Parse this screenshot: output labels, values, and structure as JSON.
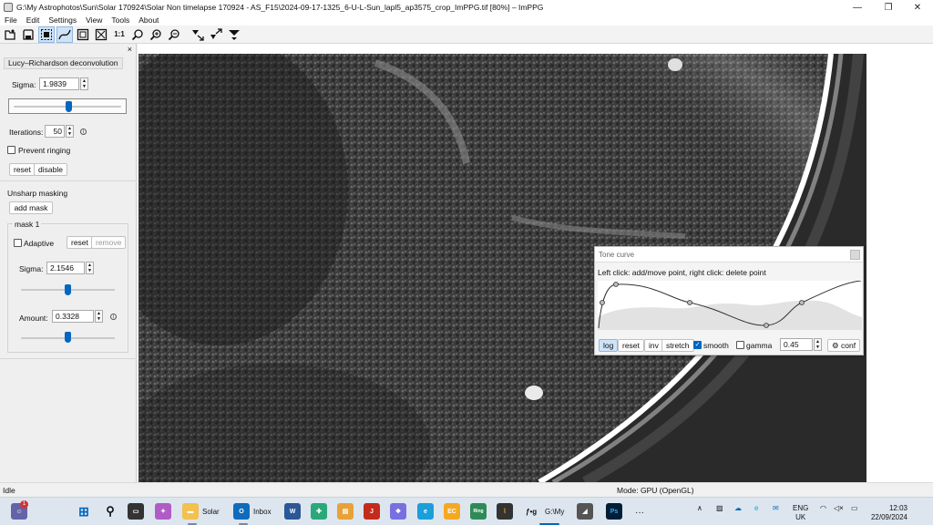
{
  "window": {
    "title": "G:\\My Astrophotos\\Sun\\Solar 170924\\Solar Non timelapse 170924 - AS_F15\\2024-09-17-1325_6-U-L-Sun_lapl5_ap3575_crop_ImPPG.tif [80%] – ImPPG",
    "minimize": "—",
    "maximize": "❐",
    "close": "✕"
  },
  "menu": [
    "File",
    "Edit",
    "Settings",
    "View",
    "Tools",
    "About"
  ],
  "toolbar": {
    "actual_size": "1:1"
  },
  "panel": {
    "close": "×",
    "lucy": {
      "title": "Lucy–Richardson deconvolution",
      "sigma_label": "Sigma:",
      "sigma_value": "1.9839",
      "iterations_label": "Iterations:",
      "iterations_value": "50",
      "prevent_ringing": "Prevent ringing",
      "reset": "reset",
      "disable": "disable"
    },
    "unsharp": {
      "title": "Unsharp masking",
      "add_mask": "add mask",
      "mask_title": "mask 1",
      "adaptive": "Adaptive",
      "reset": "reset",
      "remove": "remove",
      "sigma_label": "Sigma:",
      "sigma_value": "2.1546",
      "amount_label": "Amount:",
      "amount_value": "0.3328"
    }
  },
  "tone_curve": {
    "title": "Tone curve",
    "hint": "Left click: add/move point, right click: delete point",
    "log": "log",
    "reset": "reset",
    "inv": "inv",
    "stretch": "stretch",
    "smooth": "smooth",
    "smooth_checked": true,
    "gamma": "gamma",
    "gamma_checked": false,
    "gamma_value": "0.45",
    "conf": "conf"
  },
  "status": {
    "left": "Idle",
    "mode": "Mode: GPU (OpenGL)"
  },
  "taskbar": {
    "badge": "1",
    "solar": "Solar",
    "inbox": "Inbox",
    "fg": "ƒ•g",
    "gmy": "G:\\My",
    "lang1": "ENG",
    "lang2": "UK",
    "time": "12:03",
    "date": "22/09/2024",
    "more": "···"
  },
  "colors": {
    "accent": "#0067c0",
    "taskbar": "#dde6ef"
  }
}
